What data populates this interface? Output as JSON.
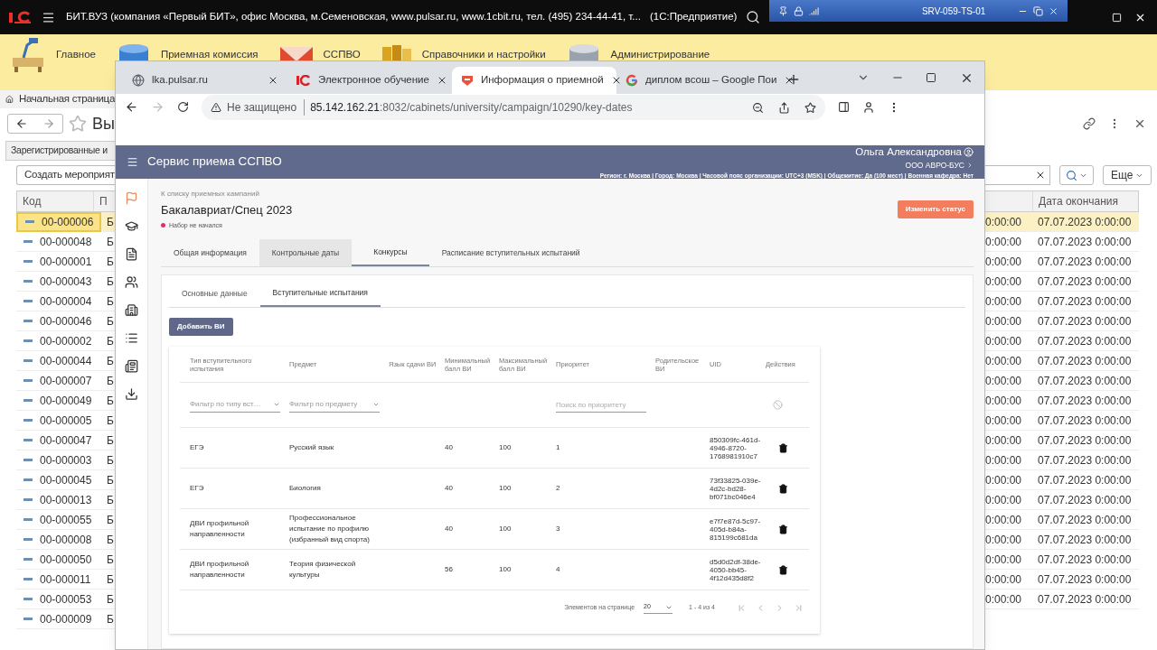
{
  "titlebar": {
    "title": "БИТ.ВУЗ (компания «Первый БИТ», офис Москва, м.Семеновская, www.pulsar.ru, www.1cbit.ru, тел. (495) 234-44-41, т...",
    "app": "(1С:Предприятие)",
    "remote_host": "SRV-059-TS-01"
  },
  "sections": [
    {
      "label": "Главное",
      "kind": "desk"
    },
    {
      "label": "Приемная комиссия",
      "kind": "database"
    },
    {
      "label": "ССПВО",
      "kind": "envelope"
    },
    {
      "label": "Справочники и настройки",
      "kind": "books"
    },
    {
      "label": "Администрирование",
      "kind": "server"
    }
  ],
  "left_panel": {
    "home_tab": "Начальная страница",
    "form_title": "Вы",
    "form_tab": "Зарегистрированные и",
    "create_button": "Создать мероприят",
    "columns": [
      "Код",
      "П"
    ],
    "rows": [
      {
        "code": "00-000006",
        "column_2": "Б",
        "selected": true
      },
      {
        "code": "00-000048",
        "column_2": "Б",
        "selected": false
      },
      {
        "code": "00-000001",
        "column_2": "Б",
        "selected": false
      },
      {
        "code": "00-000043",
        "column_2": "Б",
        "selected": false
      },
      {
        "code": "00-000004",
        "column_2": "Б",
        "selected": false
      },
      {
        "code": "00-000046",
        "column_2": "Б",
        "selected": false
      },
      {
        "code": "00-000002",
        "column_2": "Б",
        "selected": false
      },
      {
        "code": "00-000044",
        "column_2": "Б",
        "selected": false
      },
      {
        "code": "00-000007",
        "column_2": "Б",
        "selected": false
      },
      {
        "code": "00-000049",
        "column_2": "Б",
        "selected": false
      },
      {
        "code": "00-000005",
        "column_2": "Б",
        "selected": false
      },
      {
        "code": "00-000047",
        "column_2": "Б",
        "selected": false
      },
      {
        "code": "00-000003",
        "column_2": "Б",
        "selected": false
      },
      {
        "code": "00-000045",
        "column_2": "Б",
        "selected": false
      },
      {
        "code": "00-000013",
        "column_2": "Б",
        "selected": false
      },
      {
        "code": "00-000055",
        "column_2": "Б",
        "selected": false
      },
      {
        "code": "00-000008",
        "column_2": "Б",
        "selected": false
      },
      {
        "code": "00-000050",
        "column_2": "Б",
        "selected": false
      },
      {
        "code": "00-000011",
        "column_2": "Б",
        "selected": false
      },
      {
        "code": "00-000053",
        "column_2": "Б",
        "selected": false
      },
      {
        "code": "00-000009",
        "column_2": "Б",
        "selected": false
      }
    ]
  },
  "right_panel": {
    "more_button": "Еще",
    "end_column": "Дата окончания",
    "rows": [
      {
        "column_1": "0:00:00",
        "end_date": "07.07.2023 0:00:00",
        "selected": true
      },
      {
        "column_1": "0:00:00",
        "end_date": "07.07.2023 0:00:00",
        "selected": false
      },
      {
        "column_1": "0:00:00",
        "end_date": "07.07.2023 0:00:00",
        "selected": false
      },
      {
        "column_1": "0:00:00",
        "end_date": "07.07.2023 0:00:00",
        "selected": false
      },
      {
        "column_1": "0:00:00",
        "end_date": "07.07.2023 0:00:00",
        "selected": false
      },
      {
        "column_1": "0:00:00",
        "end_date": "07.07.2023 0:00:00",
        "selected": false
      },
      {
        "column_1": "0:00:00",
        "end_date": "07.07.2023 0:00:00",
        "selected": false
      },
      {
        "column_1": "0:00:00",
        "end_date": "07.07.2023 0:00:00",
        "selected": false
      },
      {
        "column_1": "0:00:00",
        "end_date": "07.07.2023 0:00:00",
        "selected": false
      },
      {
        "column_1": "0:00:00",
        "end_date": "07.07.2023 0:00:00",
        "selected": false
      },
      {
        "column_1": "0:00:00",
        "end_date": "07.07.2023 0:00:00",
        "selected": false
      },
      {
        "column_1": "0:00:00",
        "end_date": "07.07.2023 0:00:00",
        "selected": false
      },
      {
        "column_1": "0:00:00",
        "end_date": "07.07.2023 0:00:00",
        "selected": false
      },
      {
        "column_1": "0:00:00",
        "end_date": "07.07.2023 0:00:00",
        "selected": false
      },
      {
        "column_1": "0:00:00",
        "end_date": "07.07.2023 0:00:00",
        "selected": false
      },
      {
        "column_1": "0:00:00",
        "end_date": "07.07.2023 0:00:00",
        "selected": false
      },
      {
        "column_1": "0:00:00",
        "end_date": "07.07.2023 0:00:00",
        "selected": false
      },
      {
        "column_1": "0:00:00",
        "end_date": "07.07.2023 0:00:00",
        "selected": false
      },
      {
        "column_1": "0:00:00",
        "end_date": "07.07.2023 0:00:00",
        "selected": false
      },
      {
        "column_1": "0:00:00",
        "end_date": "07.07.2023 0:00:00",
        "selected": false
      }
    ]
  },
  "browser": {
    "tabs": [
      {
        "title": "lka.pulsar.ru",
        "kind": "globe",
        "selected": false
      },
      {
        "title": "Электронное обучение",
        "kind": "onec",
        "selected": false
      },
      {
        "title": "Информация о приемной",
        "kind": "shield",
        "selected": true
      },
      {
        "title": "диплом всош – Google Пои",
        "kind": "google",
        "selected": false
      }
    ],
    "address": {
      "security": "Не защищено",
      "host": "85.142.162.21",
      "path": ":8032/cabinets/university/campaign/10290/key-dates"
    },
    "page": {
      "service_title": "Сервис приема ССПВО",
      "user": {
        "name": "Ольга Александровна",
        "org": "ООО АВРО-БУС",
        "info": "Регион: г. Москва | Город: Москва | Часовой пояс организации: UTC+3 (MSK) | Общежитие: Да (100 мест) | Военная кафедра: Нет"
      },
      "rail": [
        {
          "kind": "flag",
          "selected": true
        },
        {
          "kind": "school",
          "selected": false
        },
        {
          "kind": "document",
          "selected": false
        },
        {
          "kind": "people",
          "selected": false
        },
        {
          "kind": "building",
          "selected": false
        },
        {
          "kind": "list",
          "selected": false
        },
        {
          "kind": "news",
          "selected": false
        },
        {
          "kind": "download",
          "selected": false
        }
      ],
      "breadcrumb": "К списку приемных кампаний",
      "title": "Бакалавриат/Спец 2023",
      "status": {
        "label": "Набор не начался",
        "color": "#e0306a"
      },
      "status_button": "Изменить статус",
      "tabs": [
        {
          "label": "Общая информация",
          "selected": false,
          "hovered": false
        },
        {
          "label": "Контрольные даты",
          "selected": false,
          "hovered": true
        },
        {
          "label": "Конкурсы",
          "selected": true,
          "hovered": false
        },
        {
          "label": "Расписание вступительных испытаний",
          "selected": false,
          "hovered": false
        }
      ],
      "subtabs": [
        {
          "label": "Основные данные",
          "selected": false
        },
        {
          "label": "Вступительные испытания",
          "selected": true
        }
      ],
      "add_button": "Добавить ВИ",
      "table": {
        "columns": [
          "Тип вступительного испытания",
          "Предмет",
          "Язык сдачи ВИ",
          "Минимальный балл ВИ",
          "Максимальный балл ВИ",
          "Приоритет",
          "Родительское ВИ",
          "UID",
          "Действия"
        ],
        "filters": {
          "type": "Фильтр по типу вст…",
          "subject": "Фильтр по предмету",
          "priority": {
            "placeholder": "Поиск по приоритету"
          }
        },
        "rows": [
          {
            "type": "ЕГЭ",
            "subject": "Русский язык",
            "min": "40",
            "max": "100",
            "priority": "1",
            "uid": "850309fc-461d-4946-8720-1768981910c7"
          },
          {
            "type": "ЕГЭ",
            "subject": "Биология",
            "min": "40",
            "max": "100",
            "priority": "2",
            "uid": "73f33825-039e-4d2c-bd28-bf071bc046e4"
          },
          {
            "type": "ДВИ профильной направленности",
            "subject": "Профессиональное испытание по профилю (избранный вид спорта)",
            "min": "40",
            "max": "100",
            "priority": "3",
            "uid": "e7f7e87d-5c97-405d-b84a-815199c681da"
          },
          {
            "type": "ДВИ профильной направленности",
            "subject": "Теория физической культуры",
            "min": "56",
            "max": "100",
            "priority": "4",
            "uid": "d5d0d2df-38de-4050-bb45-4f12d435d8f2"
          }
        ]
      },
      "pagination": {
        "label": "Элементов на странице",
        "page_size": "20",
        "range": "1 - 4 из 4"
      }
    }
  }
}
